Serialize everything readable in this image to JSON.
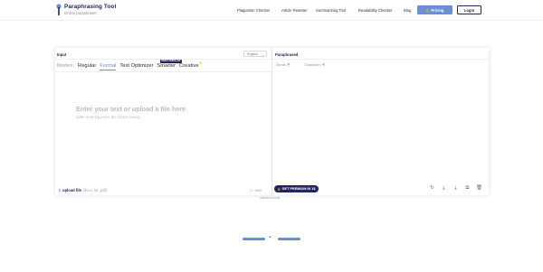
{
  "header": {
    "logo_title": "Paraphrasing Tool",
    "logo_subtitle": "Online paraphraser",
    "nav": [
      "Plagiarism Checker",
      "Article Rewriter",
      "Summarizing Tool",
      "Readability Checker",
      "Blog"
    ],
    "pricing_label": "Pricing",
    "login_label": "Login",
    "pricing_icon": "crown-icon"
  },
  "colors": {
    "brand_dark": "#24265c",
    "accent_blue": "#6a8fd6",
    "crown_yellow": "#e5c200"
  },
  "input_panel": {
    "label": "Input",
    "language": "English",
    "modes_label": "Modes:",
    "modes": [
      "Regular",
      "Formal",
      "Text Optimizer",
      "Smarter",
      "Creative"
    ],
    "active_mode": "Formal",
    "popular_badge": "MOST POPULAR",
    "placeholder": "Enter your text or upload a file here",
    "placeholder_hint": "(after entering press the button below)",
    "upload_label": "upload file",
    "upload_hint": "(docx, txt, pdf)",
    "word_limit": "0 / 1000"
  },
  "output_panel": {
    "label": "Paraphrased",
    "words_label": "Words",
    "words_count": "0",
    "chars_label": "Characters",
    "chars_count": "0",
    "premium_button": "GET PREMIUM IN 1$",
    "premium_sub": "unlimited words",
    "tool_icons": [
      "reset-icon",
      "download-icon",
      "download-alt-icon",
      "copy-icon",
      "delete-icon"
    ]
  }
}
